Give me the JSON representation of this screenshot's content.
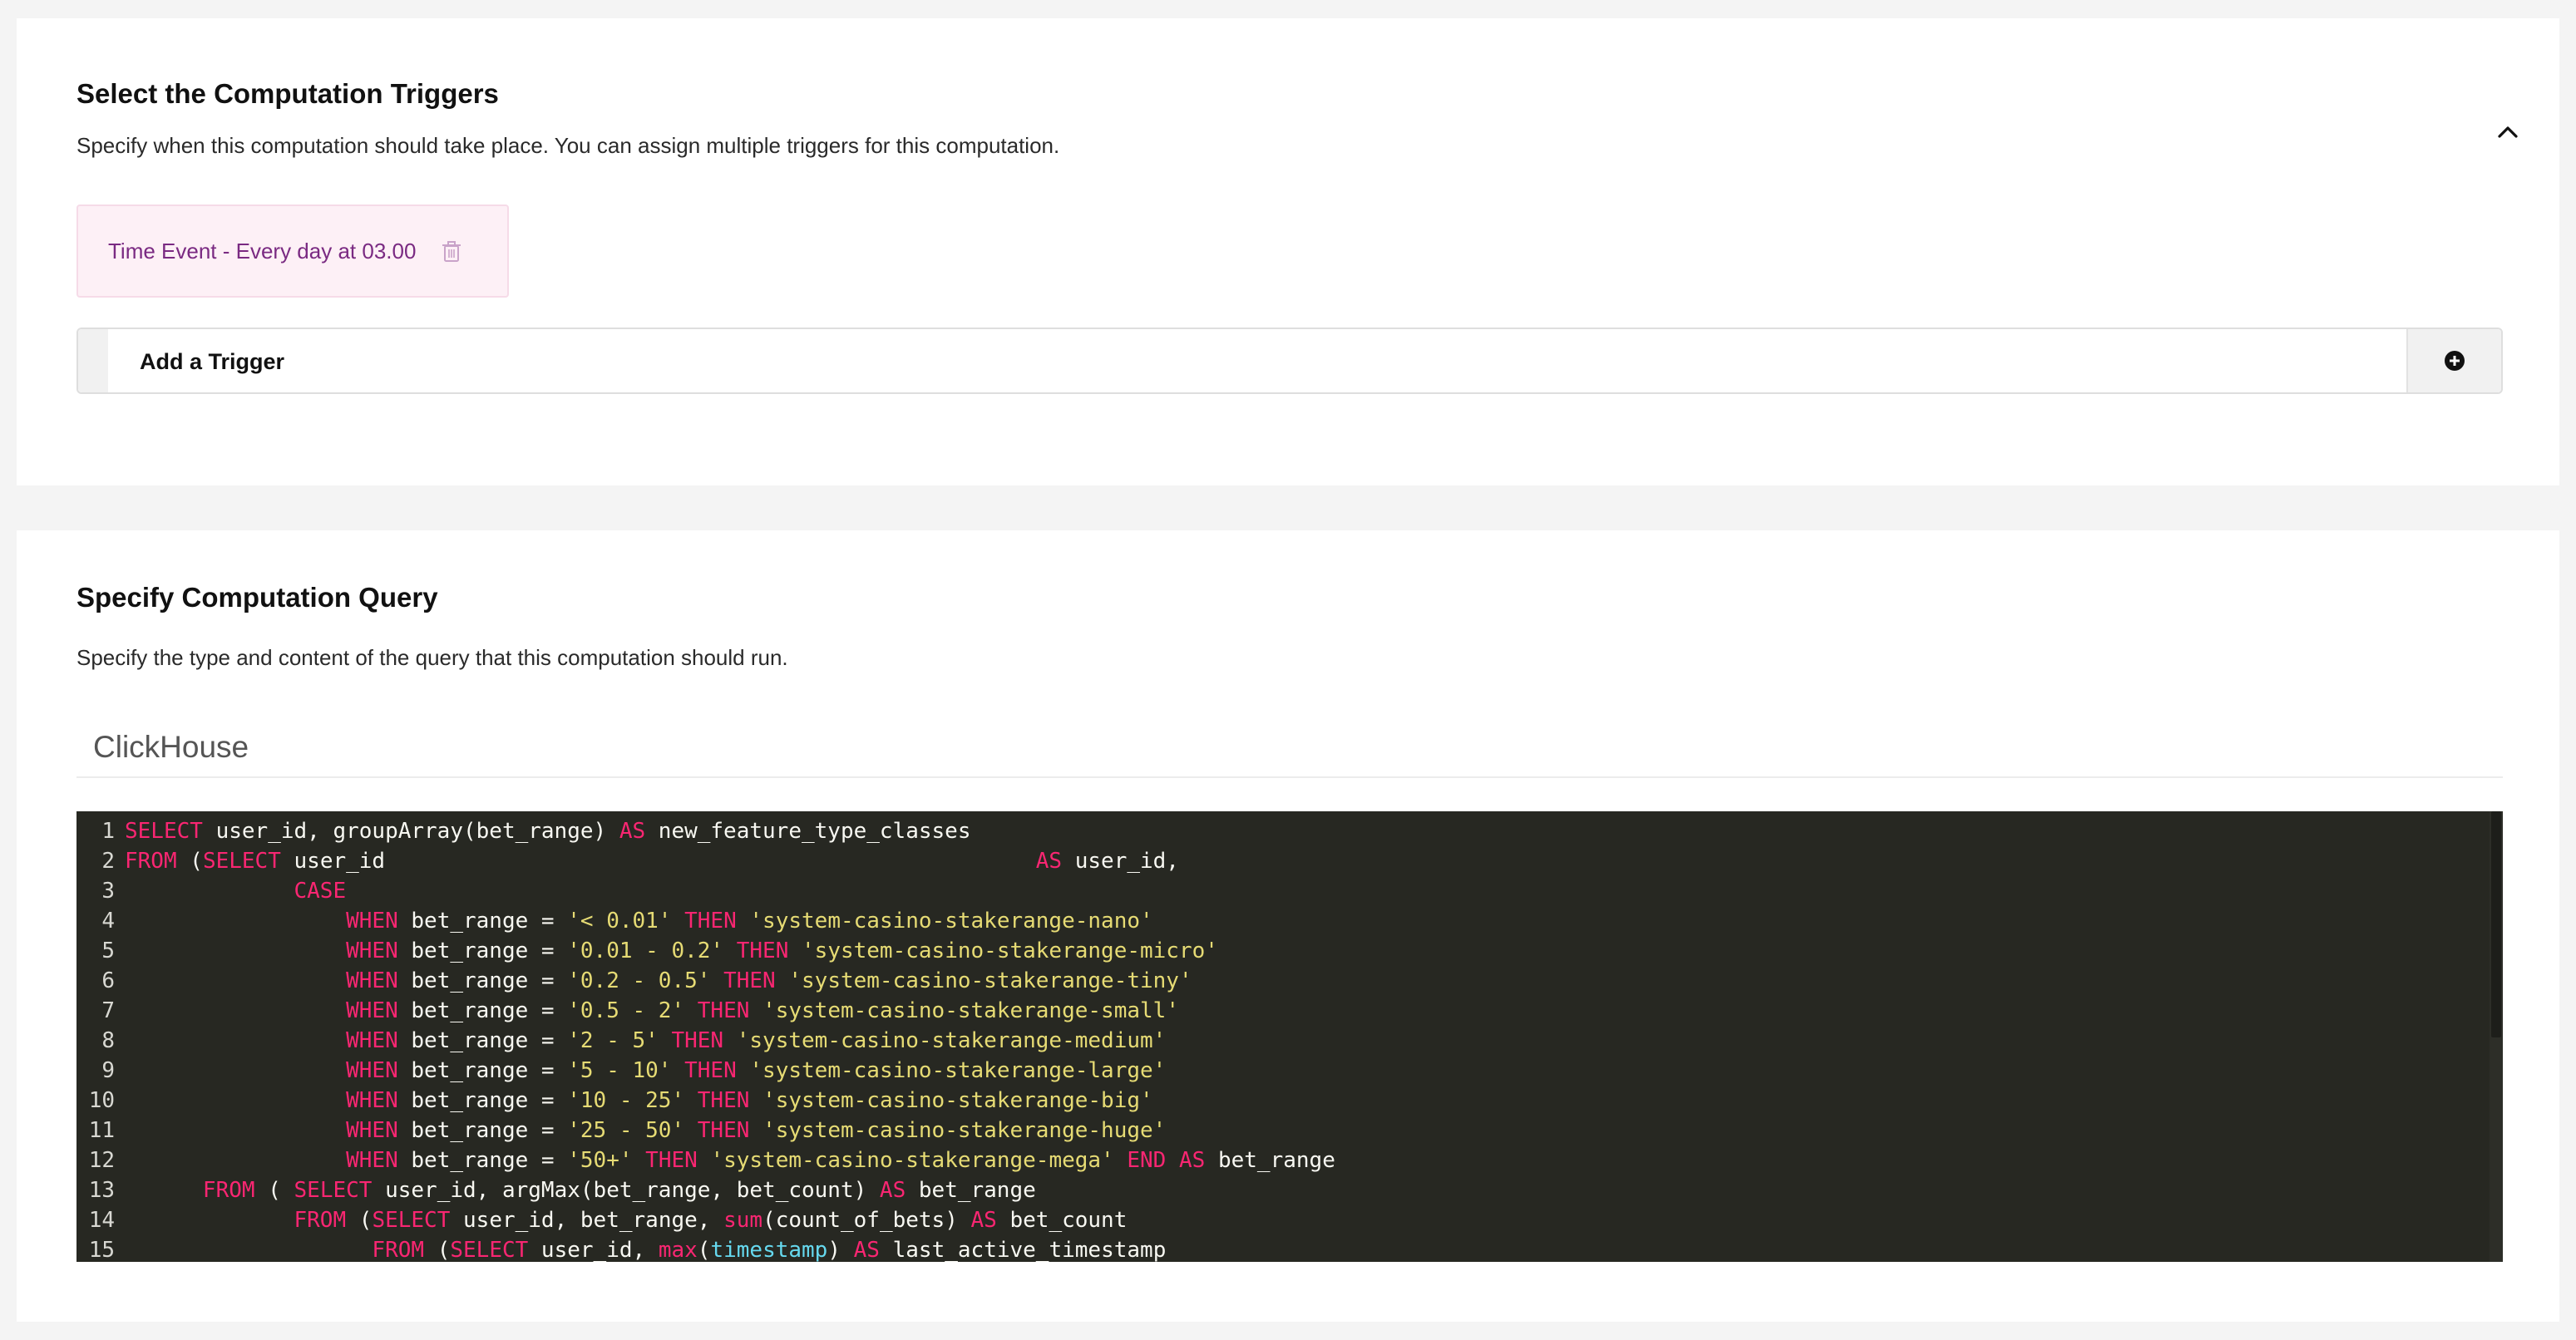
{
  "triggers_section": {
    "title": "Select the Computation Triggers",
    "description": "Specify when this computation should take place. You can assign multiple triggers for this computation.",
    "collapse_icon": "chevron-up-icon",
    "chip_label": "Time Event - Every day at 03.00",
    "chip_icon": "trash-icon",
    "add_label": "Add a Trigger",
    "add_icon": "plus-circle-icon"
  },
  "query_section": {
    "title": "Specify Computation Query",
    "description": "Specify the type and content of the query that this computation should run.",
    "engine_tab": "ClickHouse"
  },
  "colors": {
    "chip_bg": "#fdf0f6",
    "chip_text": "#7a2a82",
    "editor_bg": "#272822",
    "keyword": "#f92672",
    "string": "#e6db74",
    "function": "#66d9ef"
  },
  "code": {
    "line_numbers": [
      "1",
      "2",
      "3",
      "4",
      "5",
      "6",
      "7",
      "8",
      "9",
      "10",
      "11",
      "12",
      "13",
      "14",
      "15"
    ],
    "lines": [
      {
        "t1": "SELECT",
        "t2": " user_id, groupArray(bet_range) ",
        "t3": "AS",
        "t4": " new_feature_type_classes"
      },
      {
        "t1": "FROM",
        "t2": " (",
        "t3": "SELECT",
        "t4": " user_id                                                  ",
        "t5": "AS",
        "t6": " user_id,"
      },
      {
        "t1": "             ",
        "t2": "CASE"
      },
      {
        "t1": "                 ",
        "t2": "WHEN",
        "t3": " bet_range = ",
        "t4": "'< 0.01'",
        "t5": " ",
        "t6": "THEN",
        "t7": " ",
        "t8": "'system-casino-stakerange-nano'"
      },
      {
        "t1": "                 ",
        "t2": "WHEN",
        "t3": " bet_range = ",
        "t4": "'0.01 - 0.2'",
        "t5": " ",
        "t6": "THEN",
        "t7": " ",
        "t8": "'system-casino-stakerange-micro'"
      },
      {
        "t1": "                 ",
        "t2": "WHEN",
        "t3": " bet_range = ",
        "t4": "'0.2 - 0.5'",
        "t5": " ",
        "t6": "THEN",
        "t7": " ",
        "t8": "'system-casino-stakerange-tiny'"
      },
      {
        "t1": "                 ",
        "t2": "WHEN",
        "t3": " bet_range = ",
        "t4": "'0.5 - 2'",
        "t5": " ",
        "t6": "THEN",
        "t7": " ",
        "t8": "'system-casino-stakerange-small'"
      },
      {
        "t1": "                 ",
        "t2": "WHEN",
        "t3": " bet_range = ",
        "t4": "'2 - 5'",
        "t5": " ",
        "t6": "THEN",
        "t7": " ",
        "t8": "'system-casino-stakerange-medium'"
      },
      {
        "t1": "                 ",
        "t2": "WHEN",
        "t3": " bet_range = ",
        "t4": "'5 - 10'",
        "t5": " ",
        "t6": "THEN",
        "t7": " ",
        "t8": "'system-casino-stakerange-large'"
      },
      {
        "t1": "                 ",
        "t2": "WHEN",
        "t3": " bet_range = ",
        "t4": "'10 - 25'",
        "t5": " ",
        "t6": "THEN",
        "t7": " ",
        "t8": "'system-casino-stakerange-big'"
      },
      {
        "t1": "                 ",
        "t2": "WHEN",
        "t3": " bet_range = ",
        "t4": "'25 - 50'",
        "t5": " ",
        "t6": "THEN",
        "t7": " ",
        "t8": "'system-casino-stakerange-huge'"
      },
      {
        "t1": "                 ",
        "t2": "WHEN",
        "t3": " bet_range = ",
        "t4": "'50+'",
        "t5": " ",
        "t6": "THEN",
        "t7": " ",
        "t8": "'system-casino-stakerange-mega'",
        "t9": " ",
        "t10": "END",
        "t11": " ",
        "t12": "AS",
        "t13": " bet_range"
      },
      {
        "t1": "      ",
        "t2": "FROM",
        "t3": " ( ",
        "t4": "SELECT",
        "t5": " user_id, argMax(bet_range, bet_count) ",
        "t6": "AS",
        "t7": " bet_range"
      },
      {
        "t1": "             ",
        "t2": "FROM",
        "t3": " (",
        "t4": "SELECT",
        "t5": " user_id, bet_range, ",
        "t6": "sum",
        "t7": "(count_of_bets) ",
        "t8": "AS",
        "t9": " bet_count"
      },
      {
        "t1": "                   ",
        "t2": "FROM",
        "t3": " (",
        "t4": "SELECT",
        "t5": " user_id, ",
        "t6": "max",
        "t7": "(",
        "t8": "timestamp",
        "t9": ") ",
        "t10": "AS",
        "t11": " last_active_timestamp"
      }
    ]
  }
}
